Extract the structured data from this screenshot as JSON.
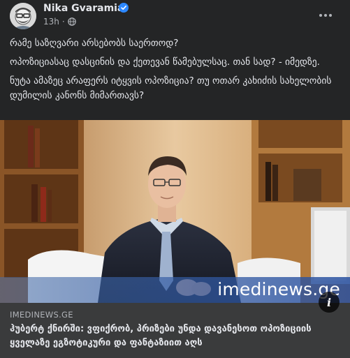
{
  "post": {
    "author": "Nika Gvaramia",
    "time": "13h",
    "more_label": "More options",
    "paragraphs": [
      "რამე საზღვარი არსებობს საერთოდ?",
      "ოპოზიციასაც დასცინის და ქეთევან წამებულსაც. თან სად? - იმედზე.",
      "ნუტა ამაზეც არაფერს იტყვის ოპოზიცია? თუ ოთარ კახიძის სახელობის დუმილის კანონს მიმართავს?"
    ]
  },
  "image": {
    "watermark": "imedinews.ge"
  },
  "link_preview": {
    "domain": "IMEDINEWS.GE",
    "title": "ჰუბერტ ქნირში: ვფიქრობ, პრიზები უნდა დავანესოთ ოპოზიციის ყველაზე ეგზოტიკური და ფანტაზიით აღს",
    "info_label": "i"
  },
  "colors": {
    "background": "#242526",
    "link_box": "#3a3b3c",
    "verified": "#2d88ff"
  }
}
